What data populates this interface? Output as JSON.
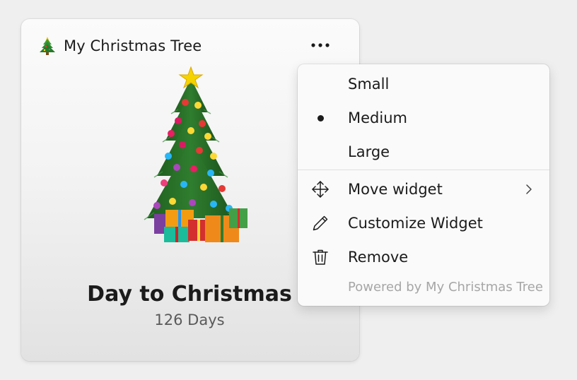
{
  "widget": {
    "title": "My Christmas Tree",
    "app_icon": "christmas-tree-icon",
    "more_icon": "more-options-icon",
    "illustration": "christmas-tree-with-presents",
    "countdown_title": "Day to Christmas",
    "countdown_value": "126 Days"
  },
  "menu": {
    "size_options": [
      {
        "label": "Small",
        "selected": false
      },
      {
        "label": "Medium",
        "selected": true
      },
      {
        "label": "Large",
        "selected": false
      }
    ],
    "actions": [
      {
        "label": "Move widget",
        "icon": "move-icon",
        "has_submenu": true
      },
      {
        "label": "Customize Widget",
        "icon": "pencil-icon",
        "has_submenu": false
      },
      {
        "label": "Remove",
        "icon": "trash-icon",
        "has_submenu": false
      }
    ],
    "footer": "Powered by My Christmas Tree"
  },
  "colors": {
    "background": "#efefef",
    "tree_green": "#2e7d32",
    "star_yellow": "#f5d300",
    "footer_text": "#a6a6a6"
  }
}
